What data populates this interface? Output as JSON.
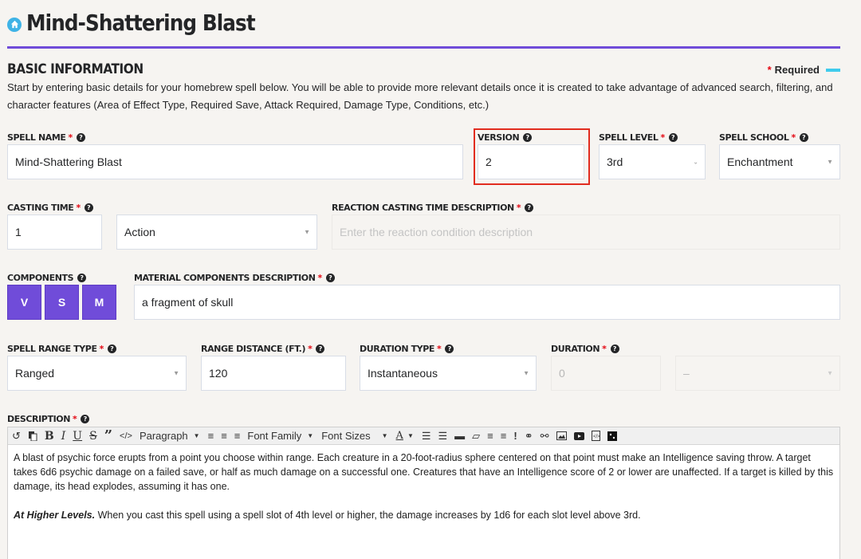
{
  "header": {
    "title": "Mind-Shattering Blast",
    "home_icon": "home-icon"
  },
  "section": {
    "title": "BASIC INFORMATION",
    "required_legend": "Required",
    "intro": "Start by entering basic details for your homebrew spell below. You will be able to provide more relevant details once it is created to take advantage of advanced search, filtering, and character features (Area of Effect Type, Required Save, Attack Required, Damage Type, Conditions, etc.)"
  },
  "fields": {
    "spell_name": {
      "label": "SPELL NAME",
      "required": "*",
      "value": "Mind-Shattering Blast"
    },
    "version": {
      "label": "VERSION",
      "value": "2"
    },
    "spell_level": {
      "label": "SPELL LEVEL",
      "required": "*",
      "value": "3rd"
    },
    "spell_school": {
      "label": "SPELL SCHOOL",
      "required": "*",
      "value": "Enchantment"
    },
    "casting_time": {
      "label": "CASTING TIME",
      "required": "*",
      "value": "1",
      "unit": "Action"
    },
    "reaction_desc": {
      "label": "REACTION CASTING TIME DESCRIPTION",
      "required": "*",
      "placeholder": "Enter the reaction condition description"
    },
    "components": {
      "label": "COMPONENTS",
      "buttons": [
        "V",
        "S",
        "M"
      ]
    },
    "material_desc": {
      "label": "MATERIAL COMPONENTS DESCRIPTION",
      "required": "*",
      "value": "a fragment of skull"
    },
    "range_type": {
      "label": "SPELL RANGE TYPE",
      "required": "*",
      "value": "Ranged"
    },
    "range_distance": {
      "label": "RANGE DISTANCE (FT.)",
      "required": "*",
      "value": "120"
    },
    "duration_type": {
      "label": "DURATION TYPE",
      "required": "*",
      "value": "Instantaneous"
    },
    "duration": {
      "label": "DURATION",
      "required": "*",
      "value": "0",
      "unit": "–"
    },
    "description": {
      "label": "DESCRIPTION",
      "required": "*"
    }
  },
  "editor": {
    "toolbar": {
      "paragraph": "Paragraph",
      "font_family": "Font Family",
      "font_sizes": "Font Sizes",
      "bold": "B",
      "italic": "I",
      "underline": "U",
      "strike": "S",
      "quote": "”",
      "code": "</>",
      "text_color": "A",
      "hr": "—",
      "exclaim": "!"
    },
    "paragraph1": "A blast of psychic force erupts from a point you choose within range. Each creature in a 20-foot-radius sphere centered on that point must make an Intelligence saving throw. A target takes 6d6 psychic damage on a failed save, or half as much damage on a successful one. Creatures that have an Intelligence score of 2 or lower are unaffected. If a target is killed by this damage, its head explodes, assuming it has one.",
    "paragraph2_lead": "At Higher Levels.",
    "paragraph2": " When you cast this spell using a spell slot of 4th level or higher, the damage increases by 1d6 for each slot level above 3rd."
  },
  "colors": {
    "accent": "#704cd9",
    "required": "#e40712",
    "info": "#3fb3e6",
    "highlight": "#e12c1f"
  }
}
